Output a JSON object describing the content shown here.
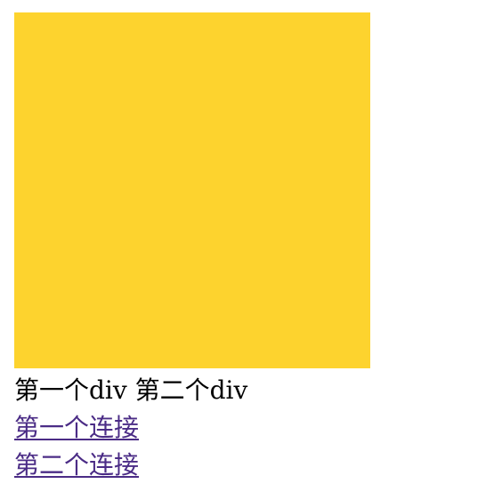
{
  "box": {
    "color": "#fdd32e"
  },
  "text": {
    "first_div": "第一个div",
    "second_div": "第二个div"
  },
  "links": {
    "first": "第一个连接",
    "second": "第二个连接",
    "color": "#4b2c86"
  }
}
